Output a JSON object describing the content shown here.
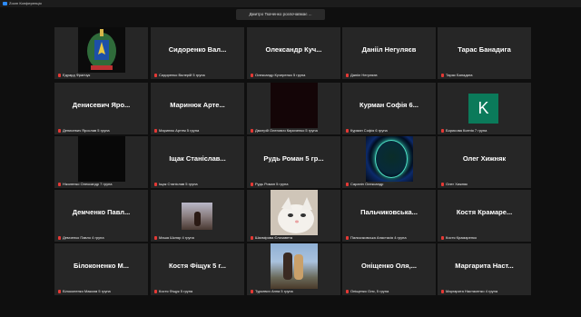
{
  "window": {
    "title": "Zoom Конференція"
  },
  "banner": "Дмитро Ткаченко розпочавмає ...",
  "participants": [
    {
      "display": "",
      "label": "Едуард Франчук",
      "media": "emblem"
    },
    {
      "display": "Сидоренко Вал...",
      "label": "Сидоренко Валерій 5 група"
    },
    {
      "display": "Олександр Куч...",
      "label": "Олександр Кучеренко 5 група"
    },
    {
      "display": "Данііл Негуляєв",
      "label": "Данііл Негуляєв"
    },
    {
      "display": "Тарас Банадига",
      "label": "Тарас Банадига"
    },
    {
      "display": "Денисевич Яро...",
      "label": "Денисевич Ярослав 5 група"
    },
    {
      "display": "Маринюк Арте...",
      "label": "Маринюк Артем 5 група"
    },
    {
      "display": "",
      "label": "Дмитрій Олегович Кириченко 5 група",
      "media": "dark-red"
    },
    {
      "display": "Курман Софія 6...",
      "label": "Курман Софія 6 група"
    },
    {
      "display": "",
      "label": "Борисова Ксенія 7 група",
      "media": "avatar",
      "avatar_letter": "K"
    },
    {
      "display": "",
      "label": "Ніколенко Олександр 7 група",
      "media": "dark"
    },
    {
      "display": "Іщак Станіслав...",
      "label": "Іщак Станіслав 5 група"
    },
    {
      "display": "Рудь Роман 5 гр...",
      "label": "Рудь Роман 5 група"
    },
    {
      "display": "",
      "label": "Сарапін Олександр",
      "media": "planet"
    },
    {
      "display": "Олег Хижняк",
      "label": "Олег Хижняк"
    },
    {
      "display": "Демченко Павл...",
      "label": "Демченко Павло 4 група"
    },
    {
      "display": "",
      "label": "Маша Шкляр 4 група",
      "media": "photo-small"
    },
    {
      "display": "",
      "label": "Шахмірова Єлизавета",
      "media": "cat"
    },
    {
      "display": "Пальчиковська...",
      "label": "Пальчиковська Анастасія 4 група"
    },
    {
      "display": "Костя Крамаре...",
      "label": "Костя Крамаренко"
    },
    {
      "display": "Білоконенко М...",
      "label": "Білоконенко Максим 5 група"
    },
    {
      "display": "Костя Фіщук 5 г...",
      "label": "Костя Фіщук 5 група"
    },
    {
      "display": "",
      "label": "Туркевич Анна 5 група",
      "media": "photo-people"
    },
    {
      "display": "Оніщенко Оля,...",
      "label": "Оніщенко Оля, 5 група"
    },
    {
      "display": "Маргарита Наст...",
      "label": "Маргарита Настасенко 4 група"
    }
  ]
}
